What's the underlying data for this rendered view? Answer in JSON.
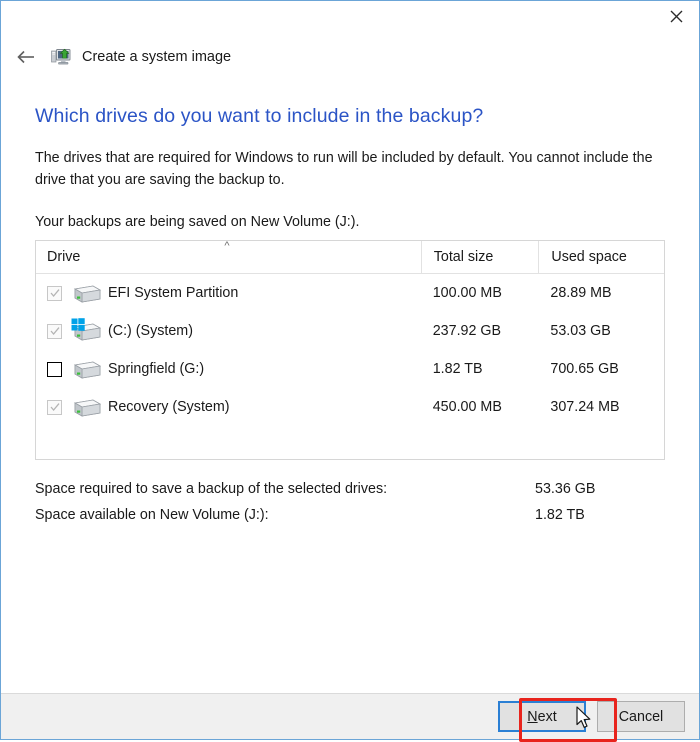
{
  "window": {
    "app_title": "Create a system image",
    "app_icon": "system-image-monitor-icon",
    "back_icon": "back-arrow-icon",
    "close_icon": "close-icon"
  },
  "page": {
    "heading": "Which drives do you want to include in the backup?",
    "intro": "The drives that are required for Windows to run will be included by default. You cannot include the drive that you are saving the backup to.",
    "saved_on": "Your backups are being saved on New Volume (J:)."
  },
  "table": {
    "columns": [
      "Drive",
      "Total size",
      "Used space"
    ],
    "sort_indicator": "ascending",
    "rows": [
      {
        "name": "EFI System Partition",
        "total_size": "100.00 MB",
        "used_space": "28.89 MB",
        "checked": true,
        "enabled": false,
        "icon": "hard-drive-icon"
      },
      {
        "name": "(C:) (System)",
        "total_size": "237.92 GB",
        "used_space": "53.03 GB",
        "checked": true,
        "enabled": false,
        "icon": "windows-drive-icon"
      },
      {
        "name": "Springfield (G:)",
        "total_size": "1.82 TB",
        "used_space": "700.65 GB",
        "checked": false,
        "enabled": true,
        "icon": "hard-drive-icon"
      },
      {
        "name": "Recovery (System)",
        "total_size": "450.00 MB",
        "used_space": "307.24 MB",
        "checked": true,
        "enabled": false,
        "icon": "hard-drive-icon"
      }
    ]
  },
  "summary": {
    "required_label": "Space required to save a backup of the selected drives:",
    "required_value": "53.36 GB",
    "available_label": "Space available on New Volume (J:):",
    "available_value": "1.82 TB"
  },
  "footer": {
    "next_label_accel": "N",
    "next_label_rest": "ext",
    "cancel_label": "Cancel"
  },
  "colors": {
    "heading_blue": "#2b54c6",
    "window_border": "#6ba5d7",
    "focus_blue": "#2a7fd4",
    "annotation_red": "#e8241d",
    "footer_bg": "#f0f0f0"
  }
}
